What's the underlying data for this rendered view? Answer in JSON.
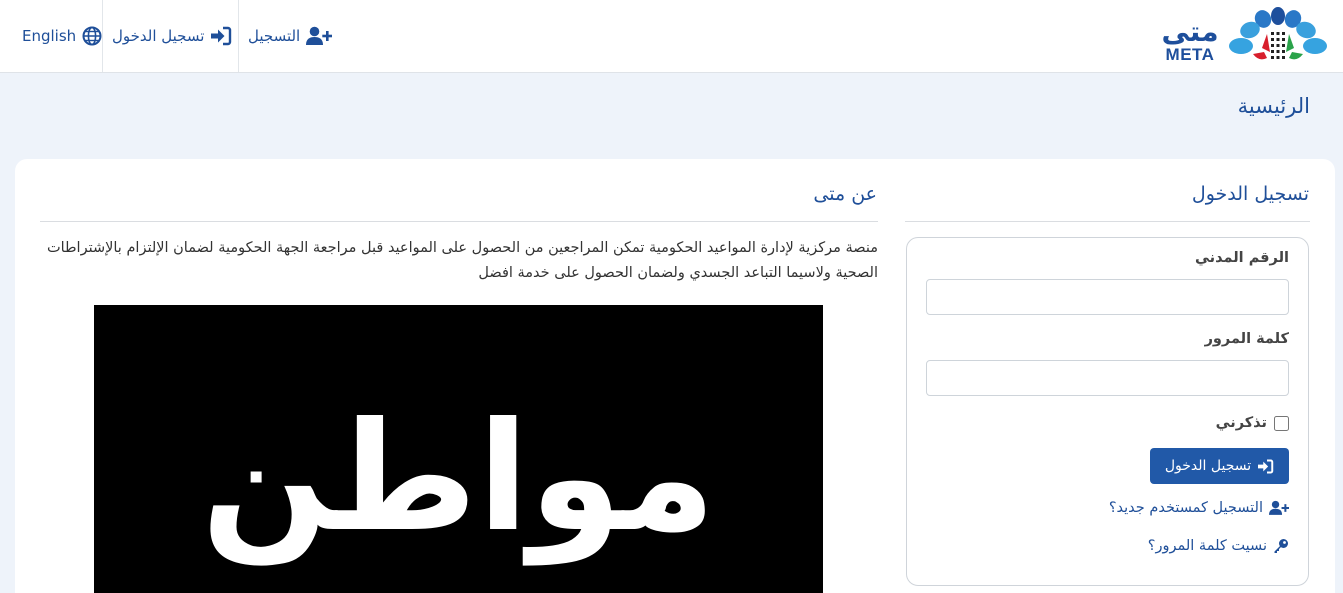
{
  "nav": {
    "language_label": "English",
    "login_label": "تسجيل الدخول",
    "register_label": "التسجيل"
  },
  "logo": {
    "arabic": "متى",
    "english": "META"
  },
  "breadcrumb": {
    "title": "الرئيسية"
  },
  "about": {
    "title": "عن متى",
    "text": "منصة مركزية لإدارة المواعيد الحكومية تمكن المراجعين من الحصول على المواعيد قبل مراجعة الجهة الحكومية لضمان الإلتزام بالإشتراطات الصحية ولاسيما التباعد الجسدي ولضمان الحصول على خدمة افضل",
    "promo_word": "مواطن"
  },
  "login": {
    "title": "تسجيل الدخول",
    "civil_id_label": "الرقم المدني",
    "civil_id_value": "",
    "password_label": "كلمة المرور",
    "password_value": "",
    "remember_label": "تذكرني",
    "submit_label": "تسجيل الدخول",
    "register_link": "التسجيل كمستخدم جديد؟",
    "forgot_link": "نسيت كلمة المرور؟"
  },
  "colors": {
    "brand_blue": "#1f4f99",
    "button_blue": "#2159a8",
    "page_bg": "#eef3fa"
  },
  "icons": {
    "language": "globe-icon",
    "login": "sign-in-icon",
    "register": "user-plus-icon",
    "forgot": "key-icon"
  }
}
